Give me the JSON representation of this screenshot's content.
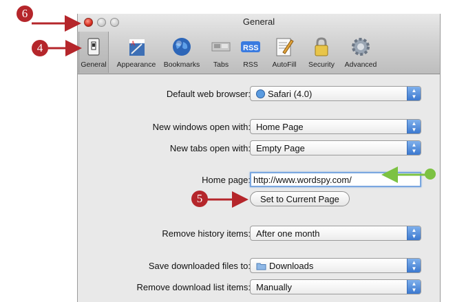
{
  "window": {
    "title": "General"
  },
  "toolbar": {
    "items": [
      {
        "label": "General",
        "icon": "general-switch-icon"
      },
      {
        "label": "Appearance",
        "icon": "appearance-icon"
      },
      {
        "label": "Bookmarks",
        "icon": "bookmarks-globe-icon"
      },
      {
        "label": "Tabs",
        "icon": "tabs-icon"
      },
      {
        "label": "RSS",
        "icon": "rss-icon"
      },
      {
        "label": "AutoFill",
        "icon": "autofill-icon"
      },
      {
        "label": "Security",
        "icon": "security-lock-icon"
      },
      {
        "label": "Advanced",
        "icon": "advanced-gear-icon"
      }
    ],
    "selected": "General"
  },
  "settings": {
    "default_browser": {
      "label": "Default web browser:",
      "value": "Safari (4.0)"
    },
    "new_windows": {
      "label": "New windows open with:",
      "value": "Home Page"
    },
    "new_tabs": {
      "label": "New tabs open with:",
      "value": "Empty Page"
    },
    "home_page": {
      "label": "Home page:",
      "value": "http://www.wordspy.com/"
    },
    "set_current_button": "Set to Current Page",
    "remove_history": {
      "label": "Remove history items:",
      "value": "After one month"
    },
    "save_downloads": {
      "label": "Save downloaded files to:",
      "value": "Downloads"
    },
    "remove_downloads": {
      "label": "Remove download list items:",
      "value": "Manually"
    }
  },
  "callouts": {
    "step4": "4",
    "step5": "5",
    "step6": "6"
  },
  "colors": {
    "callout_red": "#b5262b",
    "callout_green": "#7cc242",
    "focus_ring": "#7aa7e0",
    "stepper_blue": "#3b78cf"
  }
}
